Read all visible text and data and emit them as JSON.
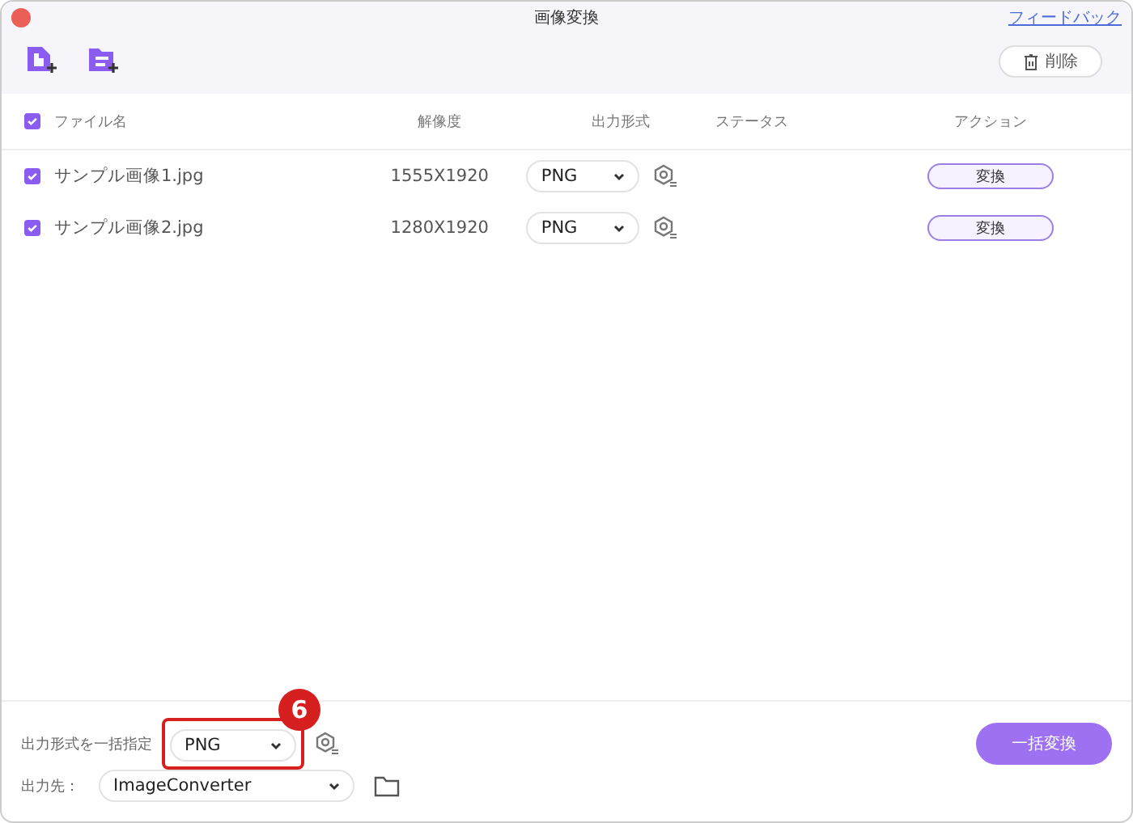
{
  "window": {
    "title": "画像変換"
  },
  "feedback_link": "フィードバック",
  "toolbar": {
    "delete_button": "削除"
  },
  "table": {
    "all_checked": true,
    "columns": [
      "ファイル名",
      "解像度",
      "出力形式",
      "ステータス",
      "アクション"
    ],
    "rows": [
      {
        "checked": true,
        "name": "サンプル画像1.jpg",
        "resolution": "1555X1920",
        "format": "PNG",
        "action": "変換"
      },
      {
        "checked": true,
        "name": "サンプル画像2.jpg",
        "resolution": "1280X1920",
        "format": "PNG",
        "action": "変換"
      }
    ]
  },
  "footer": {
    "batch_format_label": "出力形式を一括指定",
    "batch_format": "PNG",
    "step_badge": "6",
    "output_label": "出力先：",
    "output_folder": "ImageConverter",
    "convert_all_button": "一括変換"
  }
}
